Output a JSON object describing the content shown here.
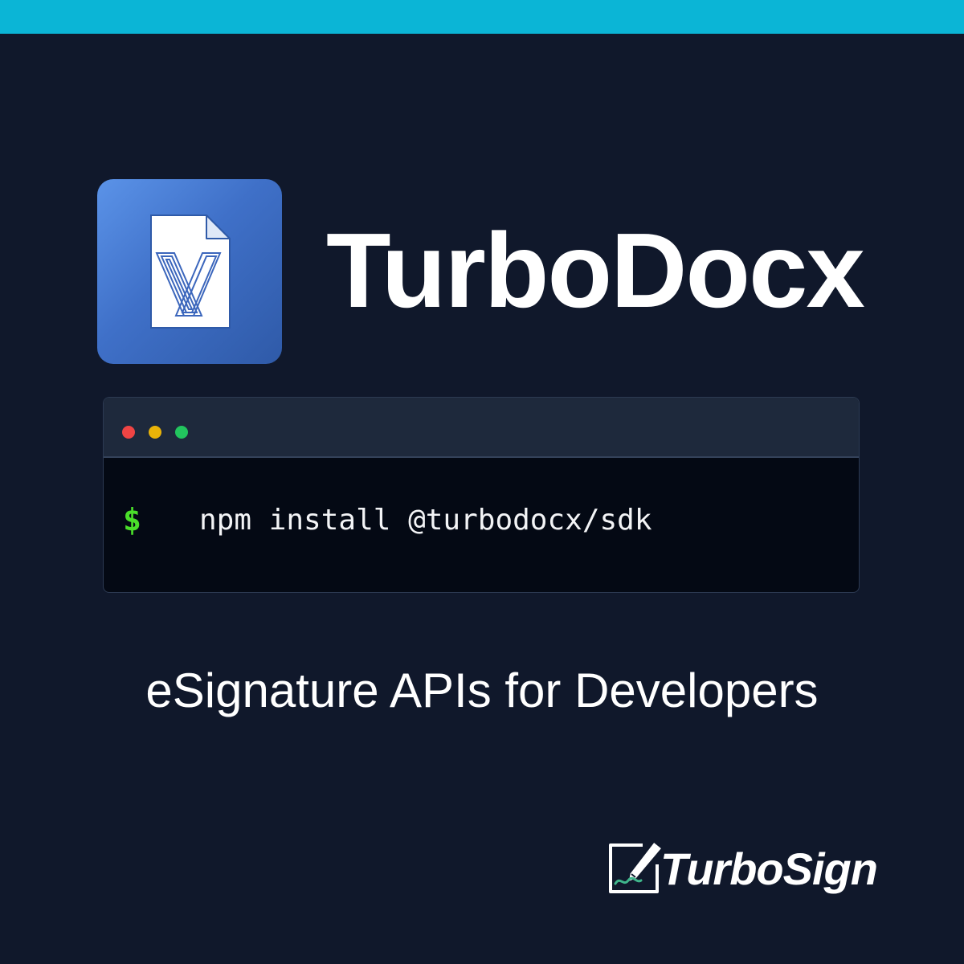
{
  "brand": {
    "name": "TurboDocx",
    "icon": "document-x-icon",
    "accent_color": "#0bb5d6",
    "background_color": "#10182b"
  },
  "terminal": {
    "prompt": "$",
    "command": "npm install @turbodocx/sdk",
    "window_controls": [
      "close-dot",
      "minimize-dot",
      "maximize-dot"
    ]
  },
  "tagline": "eSignature APIs for Developers",
  "footer": {
    "logo_text": "TurboSign",
    "logo_icon": "signature-pen-icon"
  }
}
